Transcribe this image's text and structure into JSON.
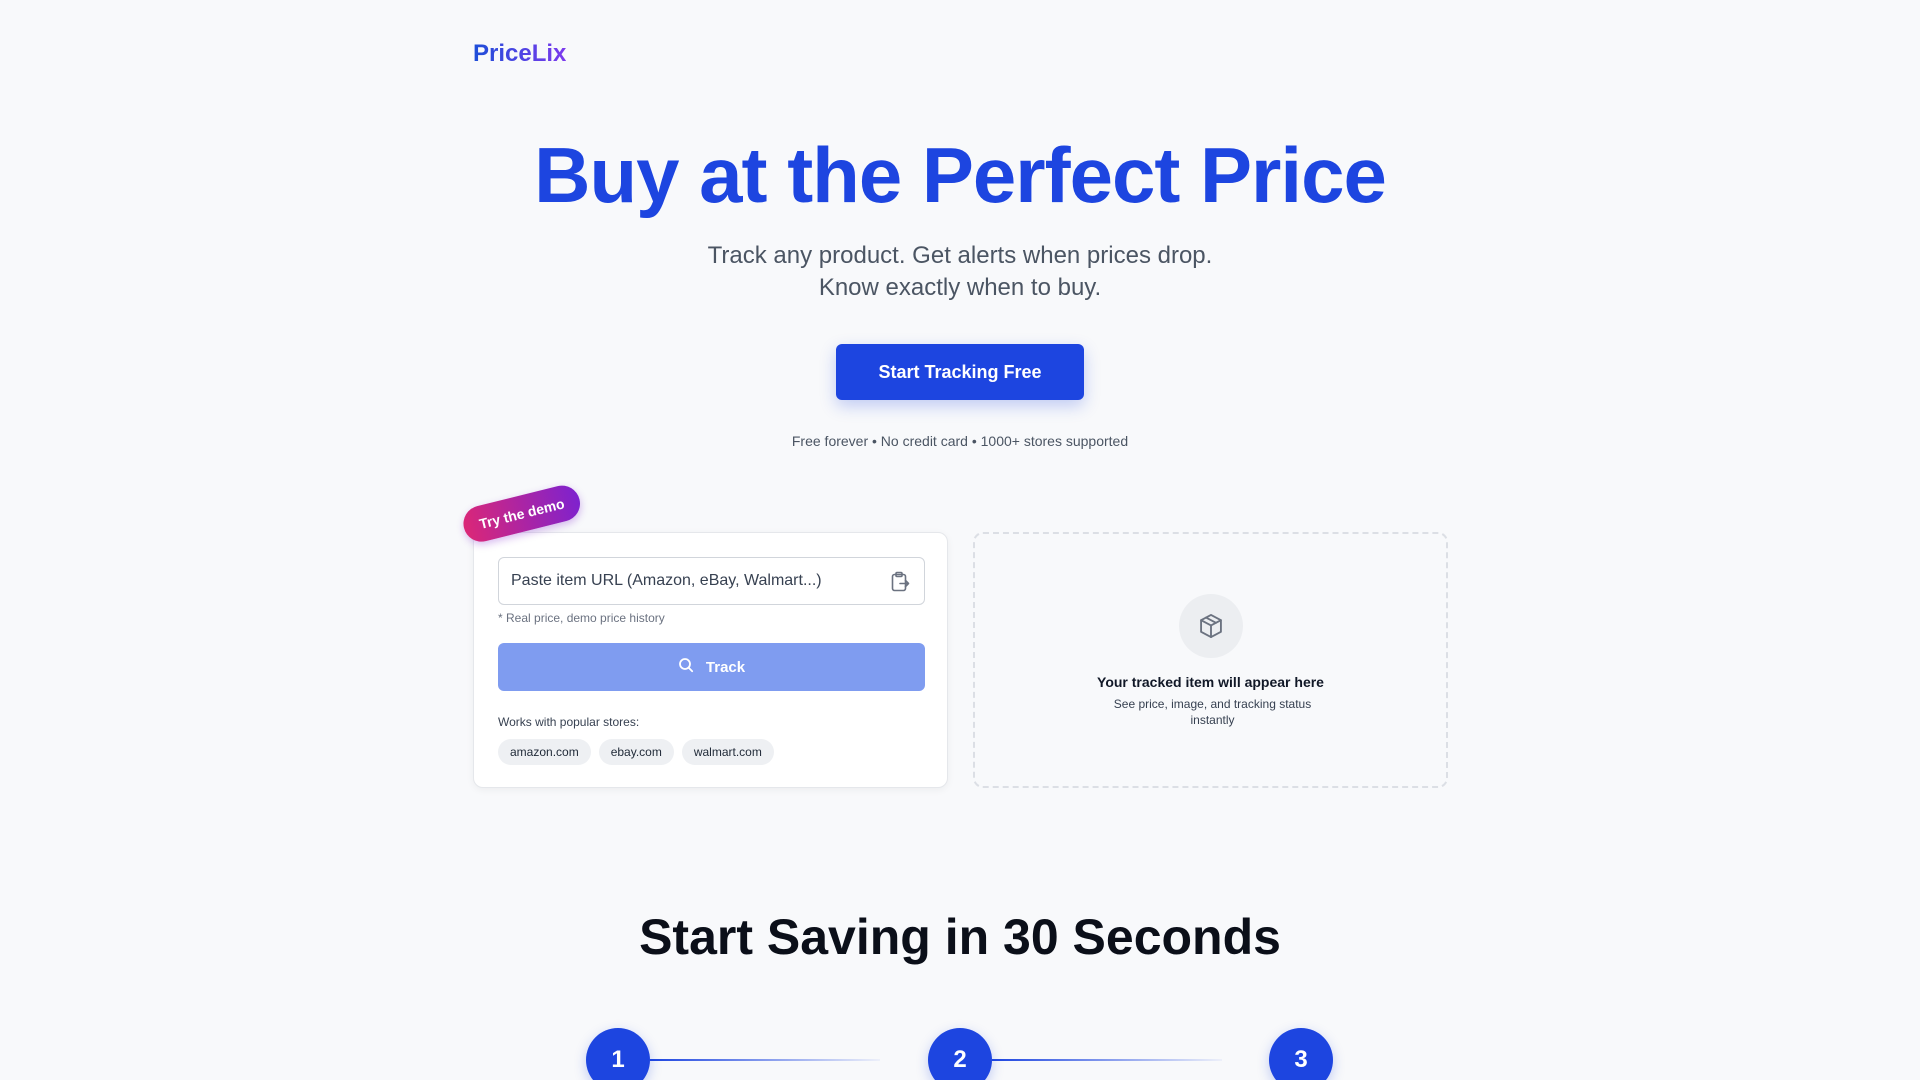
{
  "brand": {
    "name": "PriceLix"
  },
  "hero": {
    "title": "Buy at the Perfect Price",
    "subtitle_line1": "Track any product. Get alerts when prices drop.",
    "subtitle_line2": "Know exactly when to buy.",
    "cta_label": "Start Tracking Free",
    "fine_print": "Free forever • No credit card • 1000+ stores supported"
  },
  "demo": {
    "tag": "Try the demo",
    "url_placeholder": "Paste item URL (Amazon, eBay, Walmart...)",
    "url_value": "",
    "note": "* Real price, demo price history",
    "track_label": "Track",
    "stores_label": "Works with popular stores:",
    "stores": [
      "amazon.com",
      "ebay.com",
      "walmart.com"
    ],
    "icons": {
      "paste": "clipboard-paste-icon",
      "search": "search-icon"
    }
  },
  "preview": {
    "icon": "package-icon",
    "title": "Your tracked item will appear here",
    "subtitle": "See price, image, and tracking status instantly"
  },
  "how_it_works": {
    "title": "Start Saving in 30 Seconds",
    "steps": [
      "1",
      "2",
      "3"
    ]
  },
  "colors": {
    "primary": "#1d45e0",
    "primary_disabled": "#7f9cf0",
    "tag_gradient_start": "#db2777",
    "tag_gradient_end": "#7e22ce",
    "background": "#f8f9fb"
  }
}
